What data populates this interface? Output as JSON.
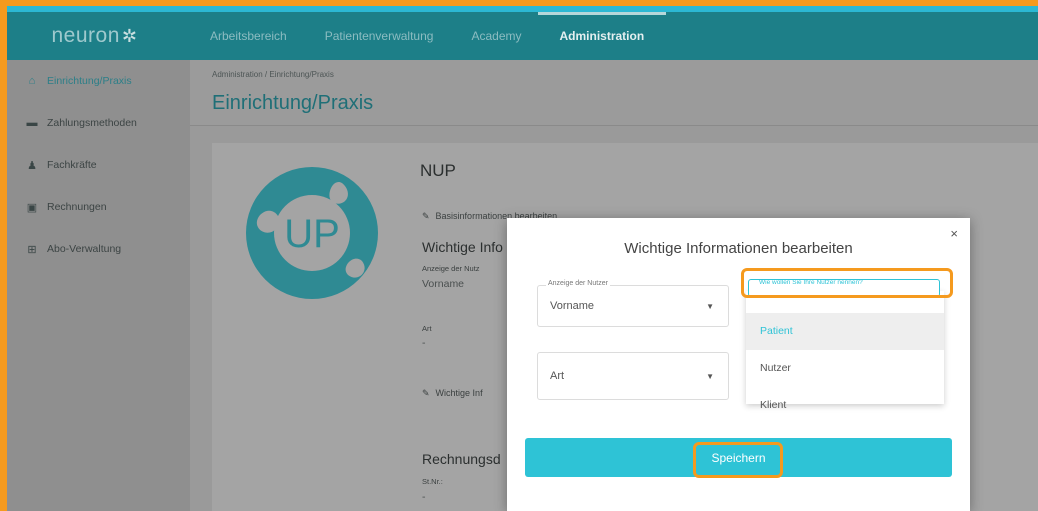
{
  "app": {
    "logo_text": "neuron"
  },
  "nav": {
    "items": [
      {
        "label": "Arbeitsbereich"
      },
      {
        "label": "Patientenverwaltung"
      },
      {
        "label": "Academy"
      },
      {
        "label": "Administration"
      }
    ]
  },
  "sidebar": {
    "items": [
      {
        "label": "Einrichtung/Praxis",
        "icon": "building-icon"
      },
      {
        "label": "Zahlungsmethoden",
        "icon": "credit-card-icon"
      },
      {
        "label": "Fachkräfte",
        "icon": "person-icon"
      },
      {
        "label": "Rechnungen",
        "icon": "invoice-icon"
      },
      {
        "label": "Abo-Verwaltung",
        "icon": "grid-icon"
      }
    ]
  },
  "page": {
    "breadcrumb": "Administration / Einrichtung/Praxis",
    "title": "Einrichtung/Praxis"
  },
  "card": {
    "logo_text": "UP",
    "name": "NUP",
    "edit_basic": "Basisinformationen bearbeiten",
    "important_title": "Wichtige Info",
    "field1_label": "Anzeige der Nutz",
    "field1_value": "Vorname",
    "field2_label": "Art",
    "field2_value": "-",
    "edit_important": "Wichtige Inf",
    "billing_title": "Rechnungsd",
    "billing_label": "St.Nr.:",
    "billing_value": "-"
  },
  "modal": {
    "title": "Wichtige Informationen bearbeiten",
    "close": "×",
    "select1_label": "Anzeige der Nutzer",
    "select1_value": "Vorname",
    "select2_value": "Art",
    "dropdown_label": "Wie wollen Sie Ihre Nutzer nennen?",
    "options": [
      {
        "label": "Patient"
      },
      {
        "label": "Nutzer"
      },
      {
        "label": "Klient"
      }
    ],
    "save_label": "Speichern"
  },
  "colors": {
    "accent": "#2ec3d6",
    "topbar": "#1d7f88",
    "highlight": "#f59a1e"
  }
}
